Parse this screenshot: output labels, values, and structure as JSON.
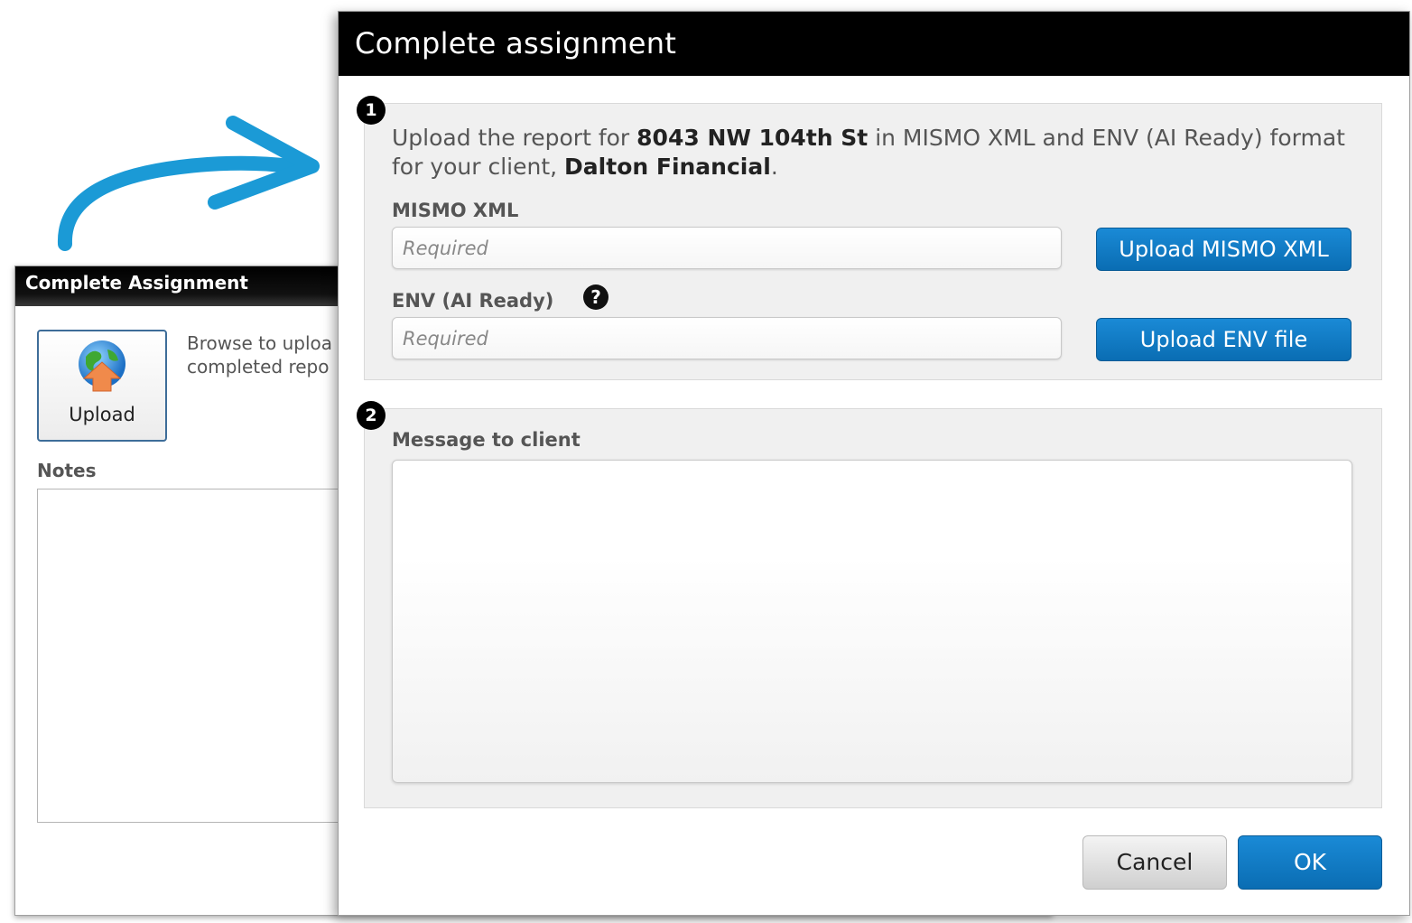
{
  "old_dialog": {
    "title": "Complete Assignment",
    "upload_button_label": "Upload",
    "description_line1": "Browse to uploa",
    "description_line2": "completed repo",
    "notes_label": "Notes"
  },
  "new_dialog": {
    "title": "Complete assignment",
    "step1": {
      "badge": "1",
      "intro_part1": "Upload the report for ",
      "address": "8043 NW 104th St",
      "intro_part2": " in MISMO XML and ENV (AI Ready) format for your client, ",
      "client": "Dalton Financial",
      "intro_part3": ".",
      "mismo_label": "MISMO XML",
      "mismo_placeholder": "Required",
      "mismo_button": "Upload MISMO XML",
      "env_label": "ENV (AI Ready)",
      "env_help": "?",
      "env_placeholder": "Required",
      "env_button": "Upload ENV file"
    },
    "step2": {
      "badge": "2",
      "message_label": "Message to client",
      "message_value": ""
    },
    "cancel_label": "Cancel",
    "ok_label": "OK"
  },
  "colors": {
    "primary_blue": "#0a6db3",
    "arrow_blue": "#1b9ad6",
    "titlebar": "#000000"
  }
}
